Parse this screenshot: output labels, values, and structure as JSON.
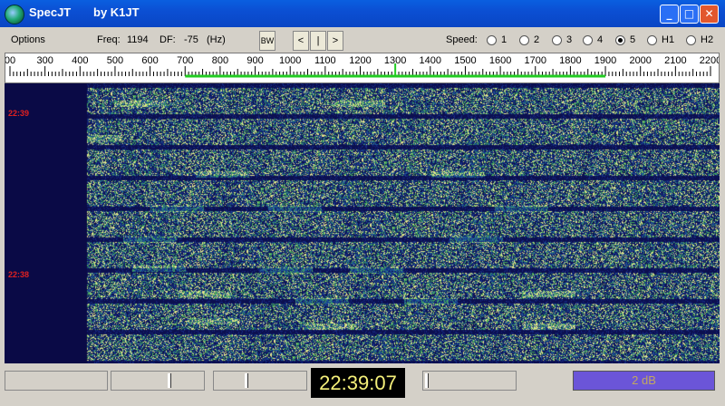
{
  "window": {
    "app_name": "SpecJT",
    "author": "by K1JT",
    "buttons": {
      "minimize": "_",
      "maximize": "□",
      "close": "✕"
    }
  },
  "menu": {
    "options": "Options",
    "freq_label": "Freq:",
    "freq_value": "1194",
    "df_label": "DF:",
    "df_value": "-75",
    "df_unit": "(Hz)",
    "bw_label": "BW",
    "nav_prev": "<",
    "nav_center": "|",
    "nav_next": ">",
    "speed_label": "Speed:",
    "speed_options": [
      "1",
      "2",
      "3",
      "4",
      "5",
      "H1",
      "H2"
    ],
    "speed_selected": "5"
  },
  "ruler": {
    "labels": [
      "00",
      "300",
      "400",
      "500",
      "600",
      "700",
      "800",
      "900",
      "1000",
      "1100",
      "1200",
      "1300",
      "1400",
      "1500",
      "1600",
      "1700",
      "1800",
      "1900",
      "2000",
      "2100",
      "2200"
    ],
    "green_range_hz": [
      700,
      1900
    ],
    "marker_hz": 1300
  },
  "spectrum": {
    "time_marks": [
      "22:39",
      "22:38"
    ]
  },
  "status": {
    "clock": "22:39:07",
    "level": "2 dB"
  },
  "colors": {
    "title_bar": "#0b4fd3",
    "waterfall_background": "#0a0a40",
    "clock_text": "#f5f07a",
    "level_bar": "#6b55d8",
    "time_mark": "#e02020"
  }
}
